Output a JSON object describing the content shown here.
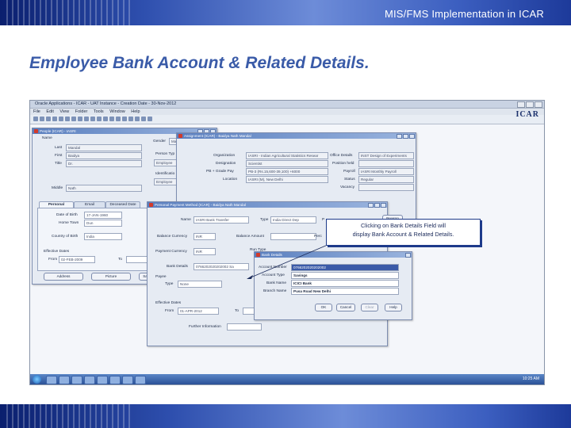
{
  "slide": {
    "header_title": "MIS/FMS Implementation in ICAR",
    "title": "Employee Bank Account & Related Details."
  },
  "app": {
    "title": "Oracle Applications - ICAR - UAT Instance - Creation Date - 30-Nov-2012",
    "menu": [
      "File",
      "Edit",
      "View",
      "Folder",
      "Tools",
      "Window",
      "Help"
    ],
    "logo": "ICAR"
  },
  "people_window": {
    "title": "People (ICAR) - IASRI",
    "name_label": "Name",
    "last_label": "Last",
    "last_value": "Mandal",
    "first_label": "First",
    "first_value": "Baidya",
    "title_label": "Title",
    "title_value": "Dr.",
    "middle_label": "Middle",
    "middle_value": "Nath",
    "gender_label": "Gender",
    "gender_value": "Mal",
    "person_type_label": "Person Typ",
    "person_type_value": "Employee",
    "identification_label": "Identificatio",
    "identification_value": "Employee",
    "tabs": [
      "Personal",
      "Email",
      "Deceased Date"
    ],
    "dob_label": "Date of Birth",
    "dob_value": "17-JAN-1960",
    "hometown_label": "Home Town",
    "hometown_value": "Dun",
    "country_label": "Country of Birth",
    "country_value": "India",
    "effective_dates_label": "Effective Dates",
    "from_label": "From",
    "from_value": "02-FEB-2009",
    "to_label": "To",
    "address_button": "Address",
    "picture_button": "Picture",
    "sa_button": "Sa"
  },
  "assignment_window": {
    "title": "Assignment (ICAR) - Baidya Nath Mandal",
    "organization_label": "Organization",
    "organization_value": "IASRI - Indian Agricultural Statistics Resear",
    "designation_label": "Designation",
    "designation_value": "Scientist",
    "pb_label": "PB + Grade Pay",
    "pb_value": "PB-3 (Rs.15,600-39,100) +6000",
    "location_label": "Location",
    "location_value": "IASRI (M), New Delhi",
    "office_details_label": "Office Details",
    "office_details_value": "INST Design of Experiments",
    "position_label": "Position held",
    "payroll_label": "Payroll",
    "payroll_value": "IASRI Monthly Payroll",
    "status_label": "Status",
    "status_value": "Regular",
    "vacancy_label": "Vacancy"
  },
  "payment_window": {
    "title": "Personal Payment Method (ICAR) - Baidya Nath Mandal",
    "name_label": "Name",
    "name_value": "IASRI Bank Transfer",
    "type_label": "Type",
    "type_value": "India Direct Dep",
    "p_label": "P",
    "reason_button": "Reason",
    "balance_currency_label": "Balance Currency",
    "balance_currency_value": "INR",
    "balance_amount_label": "Balance Amount",
    "perc_label": "Perc",
    "payment_currency_label": "Payment Currency",
    "payment_currency_value": "INR",
    "run_type_label": "Run Type",
    "bank_details_label": "Bank Details",
    "bank_details_value": "0766202020202002 Sa",
    "payee_label": "Payee",
    "payee_type_label": "Type",
    "payee_type_value": "None",
    "effective_dates_label": "Effective Dates",
    "from_label": "From",
    "from_value": "01-APR-2012",
    "to_label": "To",
    "further_info_label": "Further Information"
  },
  "bank_dialog": {
    "title": "Bank Details",
    "account_number_label": "Account Number",
    "account_number_value": "0766202020202002",
    "account_type_label": "Account Type",
    "account_type_value": "Savings",
    "bank_name_label": "Bank Name",
    "bank_name_value": "ICICI Bank",
    "branch_name_label": "Branch Name",
    "branch_name_value": "Pusa Road New Delhi",
    "ok_button": "OK",
    "cancel_button": "Cancel",
    "clear_button": "Clear",
    "help_button": "Help"
  },
  "callout": {
    "line1": "Clicking on Bank Details Field will",
    "line2": "display Bank Account & Related Details."
  },
  "taskbar": {
    "clock": "10:25 AM"
  }
}
